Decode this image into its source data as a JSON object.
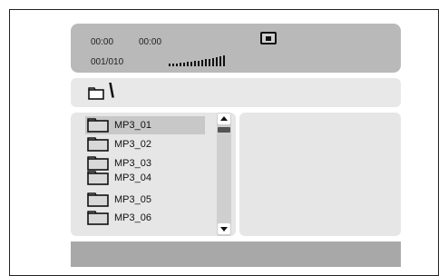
{
  "status": {
    "elapsed_time": "00:00",
    "total_time": "00:00",
    "track_counter": "001/010",
    "stop_icon": "stop-square-icon"
  },
  "path": {
    "folder_icon": "folder-icon",
    "text": "\\"
  },
  "file_list": {
    "items": [
      {
        "label": "MP3_01",
        "selected": true
      },
      {
        "label": "MP3_02",
        "selected": false
      },
      {
        "label": "MP3_03",
        "selected": false
      },
      {
        "label": "MP3_04",
        "selected": false
      },
      {
        "label": "MP3_05",
        "selected": false
      },
      {
        "label": "MP3_06",
        "selected": false
      }
    ]
  },
  "colors": {
    "status_bg": "#b9b9b9",
    "panel_bg": "#e6e6e6",
    "selected_bg": "#c8c8c8",
    "bottom_bar_bg": "#a8a8a8"
  }
}
